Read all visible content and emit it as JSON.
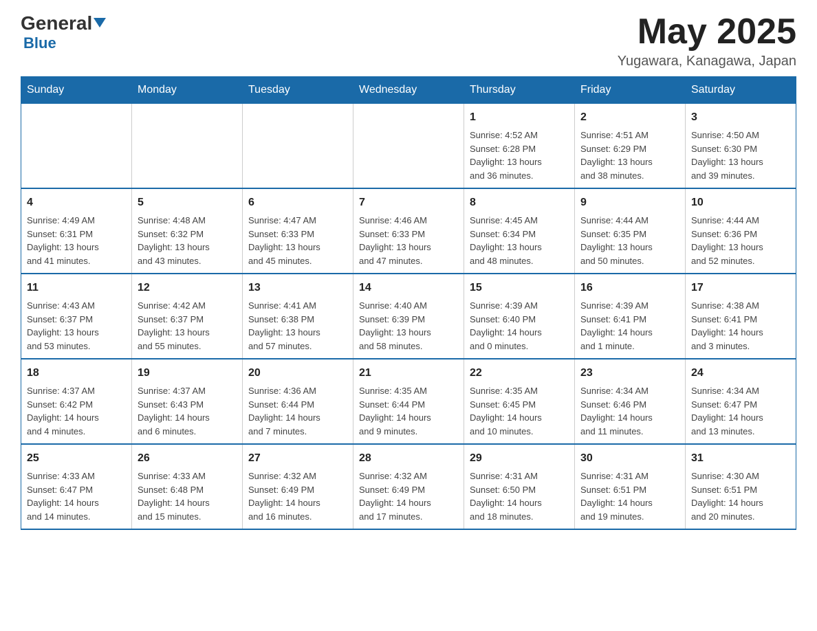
{
  "header": {
    "logo_general": "General",
    "logo_blue": "Blue",
    "month_title": "May 2025",
    "location": "Yugawara, Kanagawa, Japan"
  },
  "weekdays": [
    "Sunday",
    "Monday",
    "Tuesday",
    "Wednesday",
    "Thursday",
    "Friday",
    "Saturday"
  ],
  "weeks": [
    {
      "days": [
        {
          "num": "",
          "info": ""
        },
        {
          "num": "",
          "info": ""
        },
        {
          "num": "",
          "info": ""
        },
        {
          "num": "",
          "info": ""
        },
        {
          "num": "1",
          "info": "Sunrise: 4:52 AM\nSunset: 6:28 PM\nDaylight: 13 hours\nand 36 minutes."
        },
        {
          "num": "2",
          "info": "Sunrise: 4:51 AM\nSunset: 6:29 PM\nDaylight: 13 hours\nand 38 minutes."
        },
        {
          "num": "3",
          "info": "Sunrise: 4:50 AM\nSunset: 6:30 PM\nDaylight: 13 hours\nand 39 minutes."
        }
      ]
    },
    {
      "days": [
        {
          "num": "4",
          "info": "Sunrise: 4:49 AM\nSunset: 6:31 PM\nDaylight: 13 hours\nand 41 minutes."
        },
        {
          "num": "5",
          "info": "Sunrise: 4:48 AM\nSunset: 6:32 PM\nDaylight: 13 hours\nand 43 minutes."
        },
        {
          "num": "6",
          "info": "Sunrise: 4:47 AM\nSunset: 6:33 PM\nDaylight: 13 hours\nand 45 minutes."
        },
        {
          "num": "7",
          "info": "Sunrise: 4:46 AM\nSunset: 6:33 PM\nDaylight: 13 hours\nand 47 minutes."
        },
        {
          "num": "8",
          "info": "Sunrise: 4:45 AM\nSunset: 6:34 PM\nDaylight: 13 hours\nand 48 minutes."
        },
        {
          "num": "9",
          "info": "Sunrise: 4:44 AM\nSunset: 6:35 PM\nDaylight: 13 hours\nand 50 minutes."
        },
        {
          "num": "10",
          "info": "Sunrise: 4:44 AM\nSunset: 6:36 PM\nDaylight: 13 hours\nand 52 minutes."
        }
      ]
    },
    {
      "days": [
        {
          "num": "11",
          "info": "Sunrise: 4:43 AM\nSunset: 6:37 PM\nDaylight: 13 hours\nand 53 minutes."
        },
        {
          "num": "12",
          "info": "Sunrise: 4:42 AM\nSunset: 6:37 PM\nDaylight: 13 hours\nand 55 minutes."
        },
        {
          "num": "13",
          "info": "Sunrise: 4:41 AM\nSunset: 6:38 PM\nDaylight: 13 hours\nand 57 minutes."
        },
        {
          "num": "14",
          "info": "Sunrise: 4:40 AM\nSunset: 6:39 PM\nDaylight: 13 hours\nand 58 minutes."
        },
        {
          "num": "15",
          "info": "Sunrise: 4:39 AM\nSunset: 6:40 PM\nDaylight: 14 hours\nand 0 minutes."
        },
        {
          "num": "16",
          "info": "Sunrise: 4:39 AM\nSunset: 6:41 PM\nDaylight: 14 hours\nand 1 minute."
        },
        {
          "num": "17",
          "info": "Sunrise: 4:38 AM\nSunset: 6:41 PM\nDaylight: 14 hours\nand 3 minutes."
        }
      ]
    },
    {
      "days": [
        {
          "num": "18",
          "info": "Sunrise: 4:37 AM\nSunset: 6:42 PM\nDaylight: 14 hours\nand 4 minutes."
        },
        {
          "num": "19",
          "info": "Sunrise: 4:37 AM\nSunset: 6:43 PM\nDaylight: 14 hours\nand 6 minutes."
        },
        {
          "num": "20",
          "info": "Sunrise: 4:36 AM\nSunset: 6:44 PM\nDaylight: 14 hours\nand 7 minutes."
        },
        {
          "num": "21",
          "info": "Sunrise: 4:35 AM\nSunset: 6:44 PM\nDaylight: 14 hours\nand 9 minutes."
        },
        {
          "num": "22",
          "info": "Sunrise: 4:35 AM\nSunset: 6:45 PM\nDaylight: 14 hours\nand 10 minutes."
        },
        {
          "num": "23",
          "info": "Sunrise: 4:34 AM\nSunset: 6:46 PM\nDaylight: 14 hours\nand 11 minutes."
        },
        {
          "num": "24",
          "info": "Sunrise: 4:34 AM\nSunset: 6:47 PM\nDaylight: 14 hours\nand 13 minutes."
        }
      ]
    },
    {
      "days": [
        {
          "num": "25",
          "info": "Sunrise: 4:33 AM\nSunset: 6:47 PM\nDaylight: 14 hours\nand 14 minutes."
        },
        {
          "num": "26",
          "info": "Sunrise: 4:33 AM\nSunset: 6:48 PM\nDaylight: 14 hours\nand 15 minutes."
        },
        {
          "num": "27",
          "info": "Sunrise: 4:32 AM\nSunset: 6:49 PM\nDaylight: 14 hours\nand 16 minutes."
        },
        {
          "num": "28",
          "info": "Sunrise: 4:32 AM\nSunset: 6:49 PM\nDaylight: 14 hours\nand 17 minutes."
        },
        {
          "num": "29",
          "info": "Sunrise: 4:31 AM\nSunset: 6:50 PM\nDaylight: 14 hours\nand 18 minutes."
        },
        {
          "num": "30",
          "info": "Sunrise: 4:31 AM\nSunset: 6:51 PM\nDaylight: 14 hours\nand 19 minutes."
        },
        {
          "num": "31",
          "info": "Sunrise: 4:30 AM\nSunset: 6:51 PM\nDaylight: 14 hours\nand 20 minutes."
        }
      ]
    }
  ]
}
